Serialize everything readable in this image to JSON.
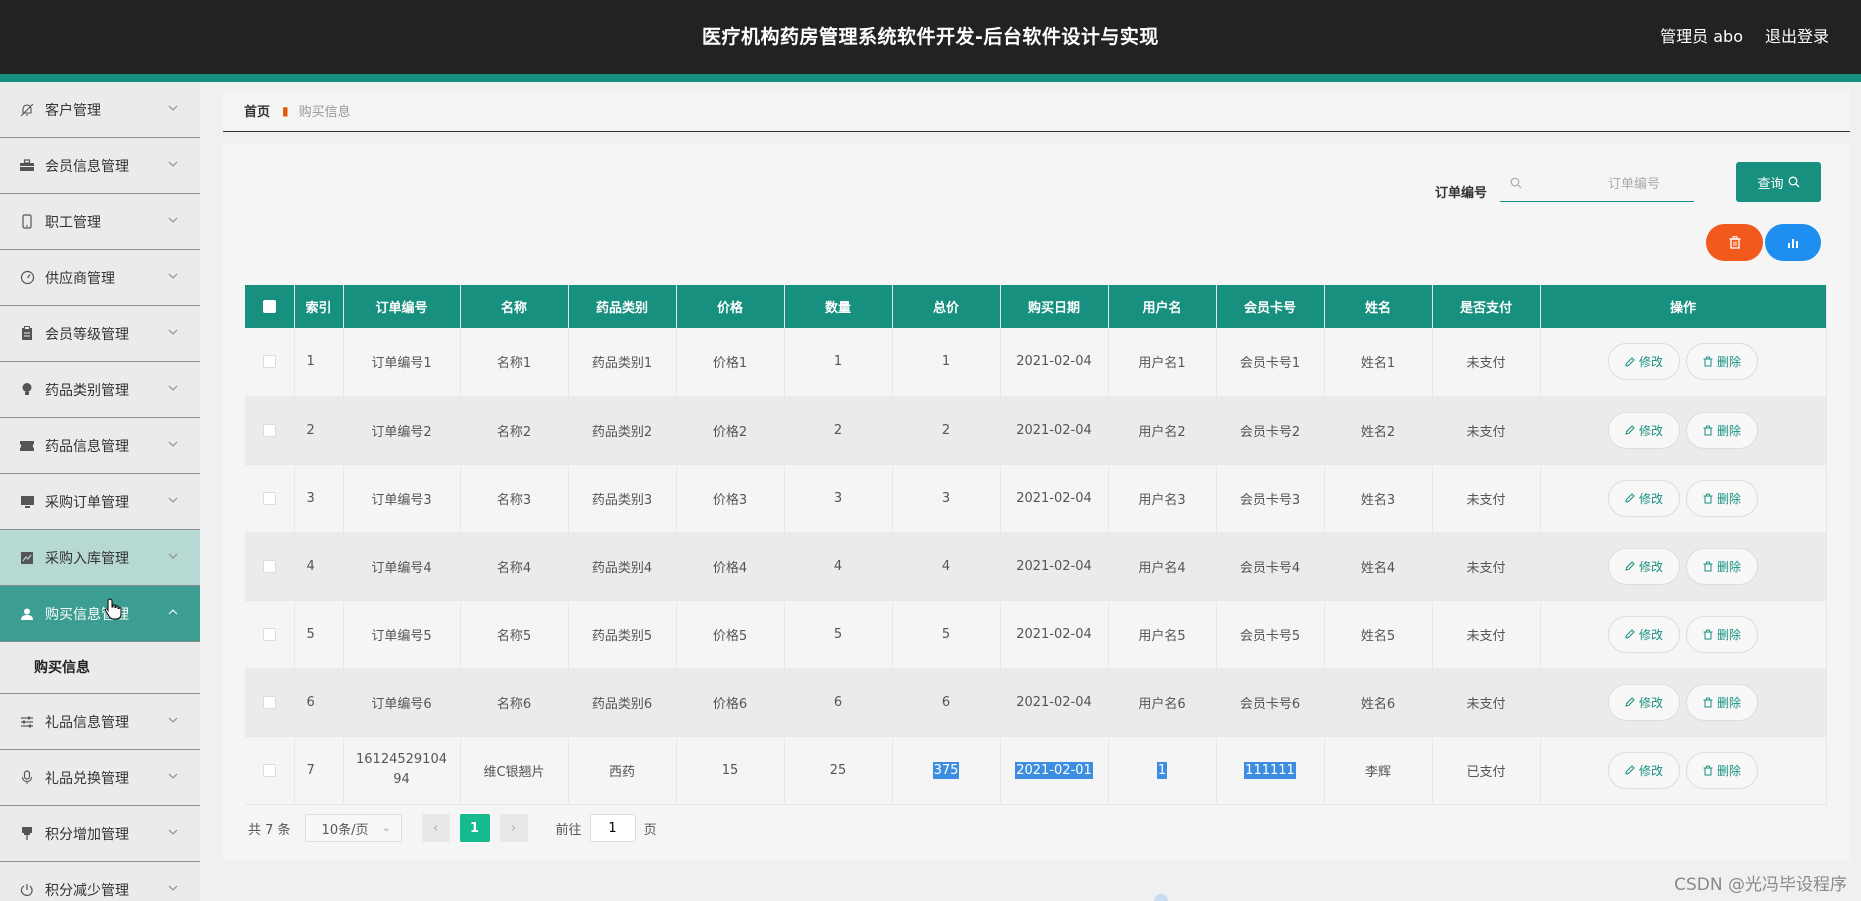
{
  "header": {
    "title": "医疗机构药房管理系统软件开发-后台软件设计与实现",
    "user": "管理员 abo",
    "logout": "退出登录"
  },
  "sidebar": {
    "items": [
      {
        "label": "客户管理",
        "icon": "bell-off-icon"
      },
      {
        "label": "会员信息管理",
        "icon": "briefcase-icon"
      },
      {
        "label": "职工管理",
        "icon": "phone-icon"
      },
      {
        "label": "供应商管理",
        "icon": "gauge-icon"
      },
      {
        "label": "会员等级管理",
        "icon": "clipboard-icon"
      },
      {
        "label": "药品类别管理",
        "icon": "bulb-icon"
      },
      {
        "label": "药品信息管理",
        "icon": "ticket-icon"
      },
      {
        "label": "采购订单管理",
        "icon": "monitor-icon"
      },
      {
        "label": "采购入库管理",
        "icon": "chart-icon"
      },
      {
        "label": "购买信息管理",
        "icon": "user-icon"
      },
      {
        "label": "礼品信息管理",
        "icon": "sliders-icon"
      },
      {
        "label": "礼品兑换管理",
        "icon": "mic-icon"
      },
      {
        "label": "积分增加管理",
        "icon": "pin-icon"
      },
      {
        "label": "积分减少管理",
        "icon": "power-icon"
      }
    ],
    "submenu": "购买信息"
  },
  "breadcrumb": {
    "home": "首页",
    "current": "购买信息"
  },
  "search": {
    "label": "订单编号",
    "placeholder": "订单编号",
    "query_label": "查询"
  },
  "table": {
    "headers": [
      "索引",
      "订单编号",
      "名称",
      "药品类别",
      "价格",
      "数量",
      "总价",
      "购买日期",
      "用户名",
      "会员卡号",
      "姓名",
      "是否支付",
      "操作"
    ],
    "rows": [
      [
        "1",
        "订单编号1",
        "名称1",
        "药品类别1",
        "价格1",
        "1",
        "1",
        "2021-02-04",
        "用户名1",
        "会员卡号1",
        "姓名1",
        "未支付"
      ],
      [
        "2",
        "订单编号2",
        "名称2",
        "药品类别2",
        "价格2",
        "2",
        "2",
        "2021-02-04",
        "用户名2",
        "会员卡号2",
        "姓名2",
        "未支付"
      ],
      [
        "3",
        "订单编号3",
        "名称3",
        "药品类别3",
        "价格3",
        "3",
        "3",
        "2021-02-04",
        "用户名3",
        "会员卡号3",
        "姓名3",
        "未支付"
      ],
      [
        "4",
        "订单编号4",
        "名称4",
        "药品类别4",
        "价格4",
        "4",
        "4",
        "2021-02-04",
        "用户名4",
        "会员卡号4",
        "姓名4",
        "未支付"
      ],
      [
        "5",
        "订单编号5",
        "名称5",
        "药品类别5",
        "价格5",
        "5",
        "5",
        "2021-02-04",
        "用户名5",
        "会员卡号5",
        "姓名5",
        "未支付"
      ],
      [
        "6",
        "订单编号6",
        "名称6",
        "药品类别6",
        "价格6",
        "6",
        "6",
        "2021-02-04",
        "用户名6",
        "会员卡号6",
        "姓名6",
        "未支付"
      ],
      [
        "7",
        "1612452910494",
        "维C银翘片",
        "西药",
        "15",
        "25",
        "375",
        "2021-02-01",
        "1",
        "111111",
        "李辉",
        "已支付"
      ]
    ],
    "edit_label": "修改",
    "delete_label": "删除"
  },
  "pager": {
    "total": "共 7 条",
    "page_size": "10条/页",
    "current_page": "1",
    "goto_label": "前往",
    "goto_value": "1",
    "page_unit": "页"
  },
  "watermark": "CSDN @光冯毕设程序",
  "colors": {
    "header_bg": "#222222",
    "accent": "#17907f",
    "danger": "#f25a1d",
    "info": "#1e8ff0",
    "sidebar_active": "#3c9e92",
    "sidebar_hover": "#b7d9d3"
  }
}
